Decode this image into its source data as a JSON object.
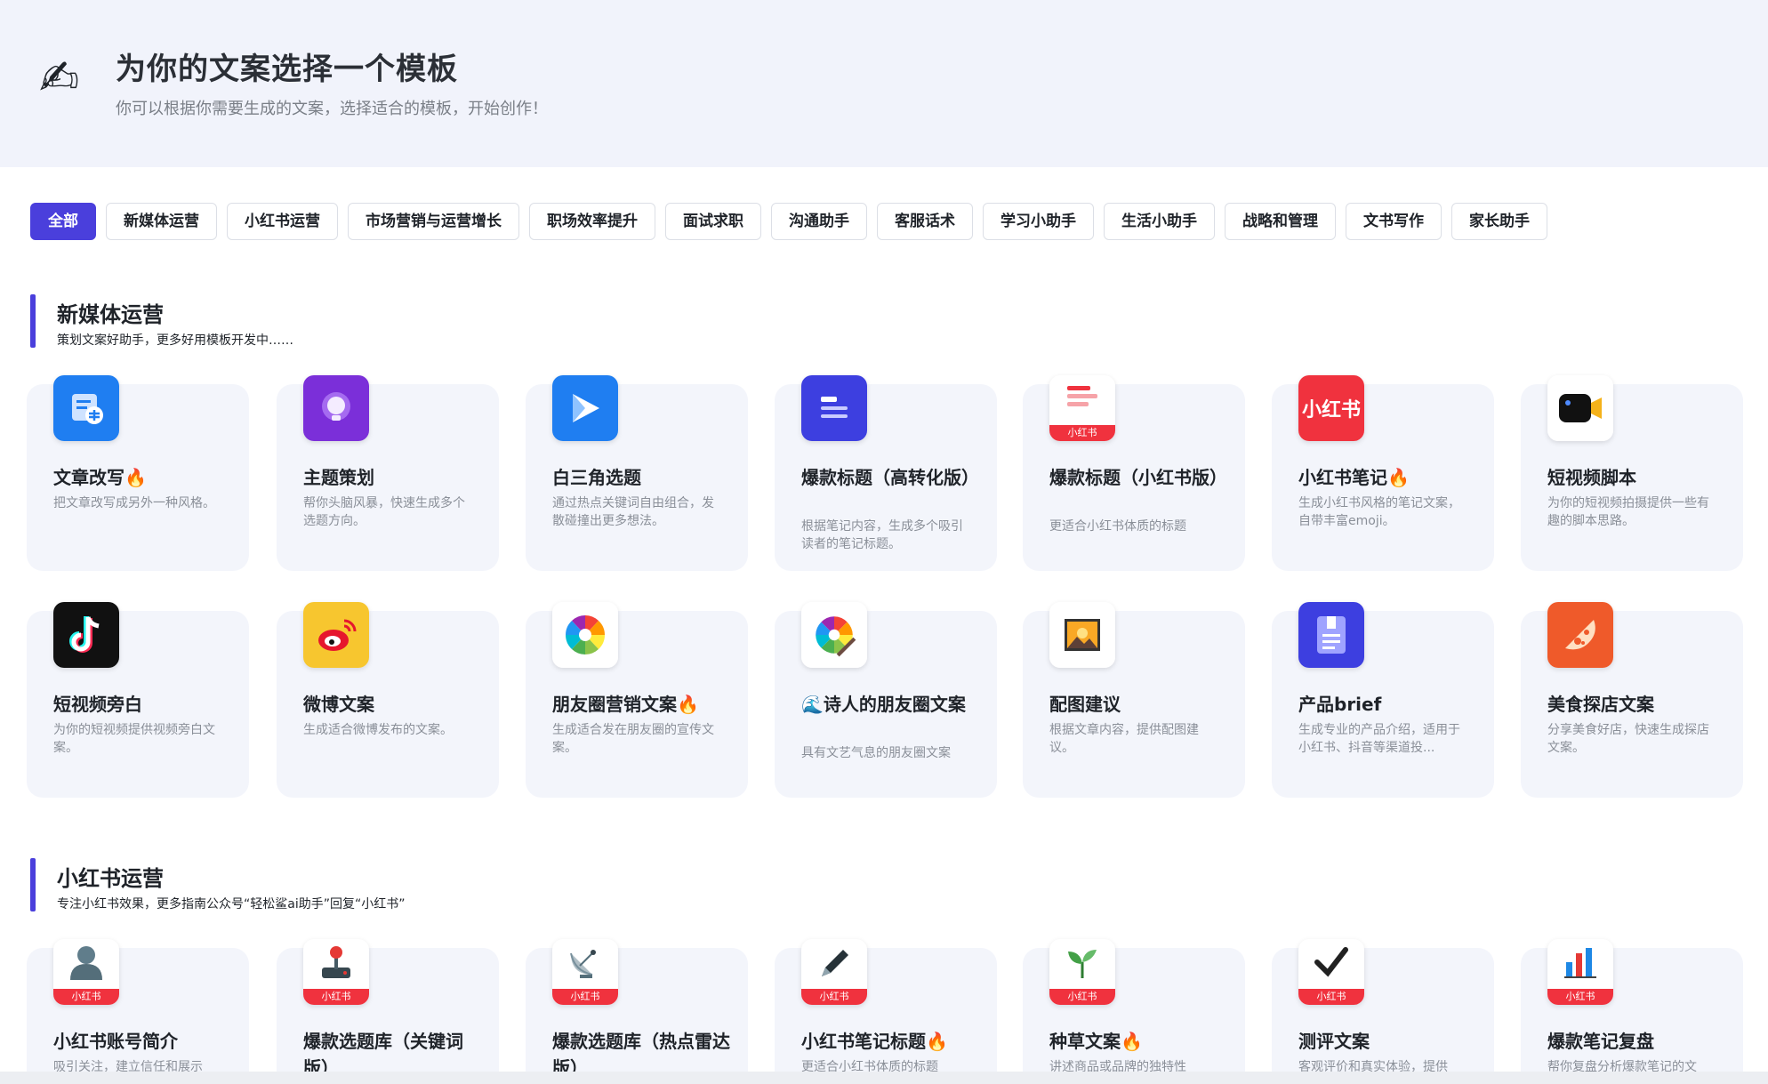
{
  "header": {
    "title": "为你的文案选择一个模板",
    "subtitle": "你可以根据你需要生成的文案，选择适合的模板，开始创作！",
    "icon": "✍"
  },
  "tabs": [
    "全部",
    "新媒体运营",
    "小红书运营",
    "市场营销与运营增长",
    "职场效率提升",
    "面试求职",
    "沟通助手",
    "客服话术",
    "学习小助手",
    "生活小助手",
    "战略和管理",
    "文书写作",
    "家长助手"
  ],
  "sections": [
    {
      "title": "新媒体运营",
      "subtitle": "策划文案好助手，更多好用模板开发中……",
      "cards": [
        {
          "title": "文章改写🔥",
          "desc": "把文章改写成另外一种风格。"
        },
        {
          "title": "主题策划",
          "desc": "帮你头脑风暴，快速生成多个选题方向。"
        },
        {
          "title": "白三角选题",
          "desc": "通过热点关键词自由组合，发散碰撞出更多想法。"
        },
        {
          "title": "爆款标题（高转化版）",
          "desc": "根据笔记内容，生成多个吸引读者的笔记标题。"
        },
        {
          "title": "爆款标题（小红书版）",
          "desc": "更适合小红书体质的标题"
        },
        {
          "title": "小红书笔记🔥",
          "desc": "生成小红书风格的笔记文案，自带丰富emoji。"
        },
        {
          "title": "短视频脚本",
          "desc": "为你的短视频拍摄提供一些有趣的脚本思路。"
        },
        {
          "title": "短视频旁白",
          "desc": "为你的短视频提供视频旁白文案。"
        },
        {
          "title": "微博文案",
          "desc": "生成适合微博发布的文案。"
        },
        {
          "title": "朋友圈营销文案🔥",
          "desc": "生成适合发在朋友圈的宣传文案。"
        },
        {
          "title": "🌊诗人的朋友圈文案",
          "desc": "具有文艺气息的朋友圈文案"
        },
        {
          "title": "配图建议",
          "desc": "根据文章内容，提供配图建议。"
        },
        {
          "title": "产品brief",
          "desc": "生成专业的产品介绍，适用于小红书、抖音等渠道投..."
        },
        {
          "title": "美食探店文案",
          "desc": "分享美食好店，快速生成探店文案。"
        }
      ]
    },
    {
      "title": "小红书运营",
      "subtitle": "专注小红书效果，更多指南公众号“轻松鲨ai助手”回复“小红书”",
      "cards": [
        {
          "title": "小红书账号简介",
          "desc": "吸引关注，建立信任和展示"
        },
        {
          "title": "爆款选题库（关键词版）",
          "desc": ""
        },
        {
          "title": "爆款选题库（热点雷达版）",
          "desc": ""
        },
        {
          "title": "小红书笔记标题🔥",
          "desc": "更适合小红书体质的标题"
        },
        {
          "title": "种草文案🔥",
          "desc": "讲述商品或品牌的独特性"
        },
        {
          "title": "测评文案",
          "desc": "客观评价和真实体验，提供"
        },
        {
          "title": "爆款笔记复盘",
          "desc": "帮你复盘分析爆款笔记的文"
        }
      ]
    }
  ],
  "labels": {
    "xhs_tag": "小红书",
    "xhs_logo": "小红书"
  },
  "icons": {
    "s0": [
      "doc-edit-icon",
      "lightbulb-icon",
      "play-triangle-icon",
      "title-lines-icon",
      "red-lines-icon",
      "xiaohongshu-logo-icon",
      "video-camera-icon",
      "tiktok-icon",
      "weibo-icon",
      "pinwheel-icon",
      "pinwheel-brush-icon",
      "picture-icon",
      "document-icon",
      "pizza-icon"
    ],
    "s1": [
      "user-silhouette-icon",
      "joystick-icon",
      "satellite-dish-icon",
      "pen-icon",
      "sprout-icon",
      "checkmark-icon",
      "bar-chart-icon"
    ]
  },
  "colors": {
    "accent": "#4a3fdc",
    "xhs_red": "#f0323e",
    "card_bg": "#f3f5fb",
    "header_bg": "#f1f3fb"
  }
}
